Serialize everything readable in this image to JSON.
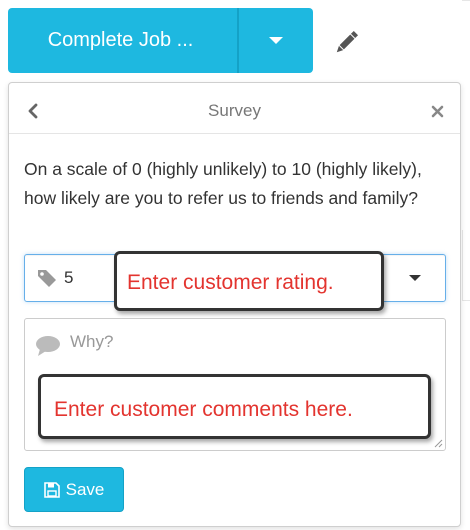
{
  "toolbar": {
    "complete_job_label": "Complete Job ...",
    "dropdown_icon": "caret-down-icon",
    "edit_icon": "pencil-icon"
  },
  "survey": {
    "title": "Survey",
    "back_icon": "chevron-left-icon",
    "close_icon": "close-icon",
    "question": "On a scale of 0 (highly unlikely) to 10 (highly likely), how likely are you to refer us to friends and family?",
    "rating": {
      "icon": "tag-icon",
      "value": "5"
    },
    "comments": {
      "icon": "comment-icon",
      "placeholder": "Why?"
    },
    "save_label": "Save",
    "save_icon": "floppy-disk-icon"
  },
  "annotations": {
    "rating_note": "Enter customer rating.",
    "comments_note": "Enter customer comments here."
  },
  "colors": {
    "primary": "#1eb8e0",
    "annotation_text": "#e3342f"
  }
}
